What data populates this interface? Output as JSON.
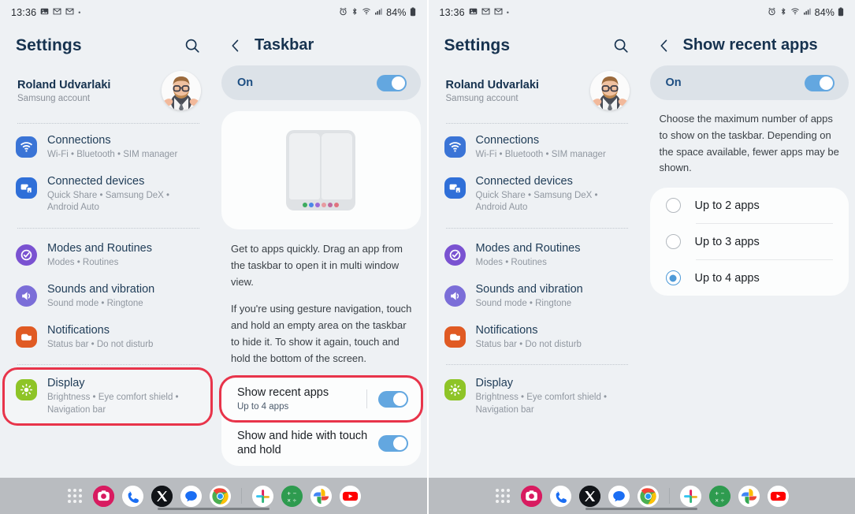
{
  "statusbar": {
    "time": "13:36",
    "left_icons": [
      "gallery-icon",
      "mail-icon",
      "mail-icon"
    ],
    "dot": "•",
    "right_icons": [
      "alarm-icon",
      "bluetooth-icon",
      "wifi-icon",
      "signal-icon"
    ],
    "battery": "84%"
  },
  "colors": {
    "accent_toggle": "#63a7e0",
    "highlight_red": "#e8344a",
    "title_blue": "#16324f",
    "screen_bg": "#eef1f4",
    "card_bg": "#fcfdfd",
    "on_card_bg": "#dce2e8",
    "dock_bg": "#b9bcc0",
    "radio_selected": "#4e9ad8"
  },
  "settings": {
    "title": "Settings",
    "search_icon": "search-icon",
    "account": {
      "name": "Roland Udvarlaki",
      "subtitle": "Samsung account",
      "avatar": "user-avatar"
    },
    "items": [
      {
        "id": "connections",
        "title": "Connections",
        "subtitle": "Wi-Fi  •  Bluetooth  •  SIM manager",
        "icon": "wifi-icon",
        "icon_color": "#3a74d6",
        "highlight": false
      },
      {
        "id": "connected-devices",
        "title": "Connected devices",
        "subtitle": "Quick Share  •  Samsung DeX  •  Android Auto",
        "icon": "devices-icon",
        "icon_color": "#2f6fd8",
        "highlight": false
      },
      {
        "id": "modes-and-routines",
        "title": "Modes and Routines",
        "subtitle": "Modes  •  Routines",
        "icon": "check-circle-icon",
        "icon_color": "#7a52d1",
        "highlight": false
      },
      {
        "id": "sounds-and-vibration",
        "title": "Sounds and vibration",
        "subtitle": "Sound mode  •  Ringtone",
        "icon": "speaker-icon",
        "icon_color": "#7b6ed8",
        "highlight": false
      },
      {
        "id": "notifications",
        "title": "Notifications",
        "subtitle": "Status bar  •  Do not disturb",
        "icon": "notification-icon",
        "icon_color": "#e05a23",
        "highlight": false
      },
      {
        "id": "display",
        "title": "Display",
        "subtitle": "Brightness  •  Eye comfort shield  •  Navigation bar",
        "icon": "brightness-icon",
        "icon_color": "#8ec427",
        "highlight": true
      }
    ]
  },
  "taskbar_detail": {
    "back_icon": "back-chevron-icon",
    "title": "Taskbar",
    "on_label": "On",
    "toggle_on": true,
    "preview_icon": "split-screen-preview",
    "preview_dots": [
      "#3dab5f",
      "#4a86e8",
      "#9a6ad8",
      "#e79aa0",
      "#c06a9e",
      "#e0737f"
    ],
    "description": [
      "Get to apps quickly. Drag an app from the taskbar to open it in multi window view.",
      "If you're using gesture navigation, touch and hold an empty area on the taskbar to hide it. To show it again, touch and hold the bottom of the screen."
    ],
    "options": [
      {
        "id": "show-recent-apps",
        "title": "Show recent apps",
        "subtitle": "Up to 4 apps",
        "toggle_on": true,
        "has_separator": true,
        "highlight": true
      },
      {
        "id": "show-and-hide-with-touch-and-hold",
        "title": "Show and hide with touch and hold",
        "subtitle": "",
        "toggle_on": true,
        "has_separator": false,
        "highlight": false
      }
    ]
  },
  "recent_apps_detail": {
    "back_icon": "back-chevron-icon",
    "title": "Show recent apps",
    "on_label": "On",
    "toggle_on": true,
    "description": "Choose the maximum number of apps to show on the taskbar. Depending on the space available, fewer apps may be shown.",
    "radio_options": [
      {
        "id": "up-to-2-apps",
        "label": "Up to 2 apps",
        "selected": false
      },
      {
        "id": "up-to-3-apps",
        "label": "Up to 3 apps",
        "selected": false
      },
      {
        "id": "up-to-4-apps",
        "label": "Up to 4 apps",
        "selected": true
      }
    ]
  },
  "dock": {
    "apps_button": "all-apps-icon",
    "icons": [
      {
        "id": "instagram",
        "name": "instagram-icon"
      },
      {
        "id": "phone",
        "name": "phone-icon"
      },
      {
        "id": "x",
        "name": "x-twitter-icon"
      },
      {
        "id": "messages",
        "name": "messages-icon"
      },
      {
        "id": "chrome",
        "name": "chrome-icon"
      }
    ],
    "recent_icons": [
      {
        "id": "slack",
        "name": "slack-icon"
      },
      {
        "id": "calculator",
        "name": "calculator-icon"
      },
      {
        "id": "google-photos",
        "name": "google-photos-icon"
      },
      {
        "id": "youtube",
        "name": "youtube-icon"
      }
    ],
    "nav_pill": "home-gesture-pill"
  }
}
